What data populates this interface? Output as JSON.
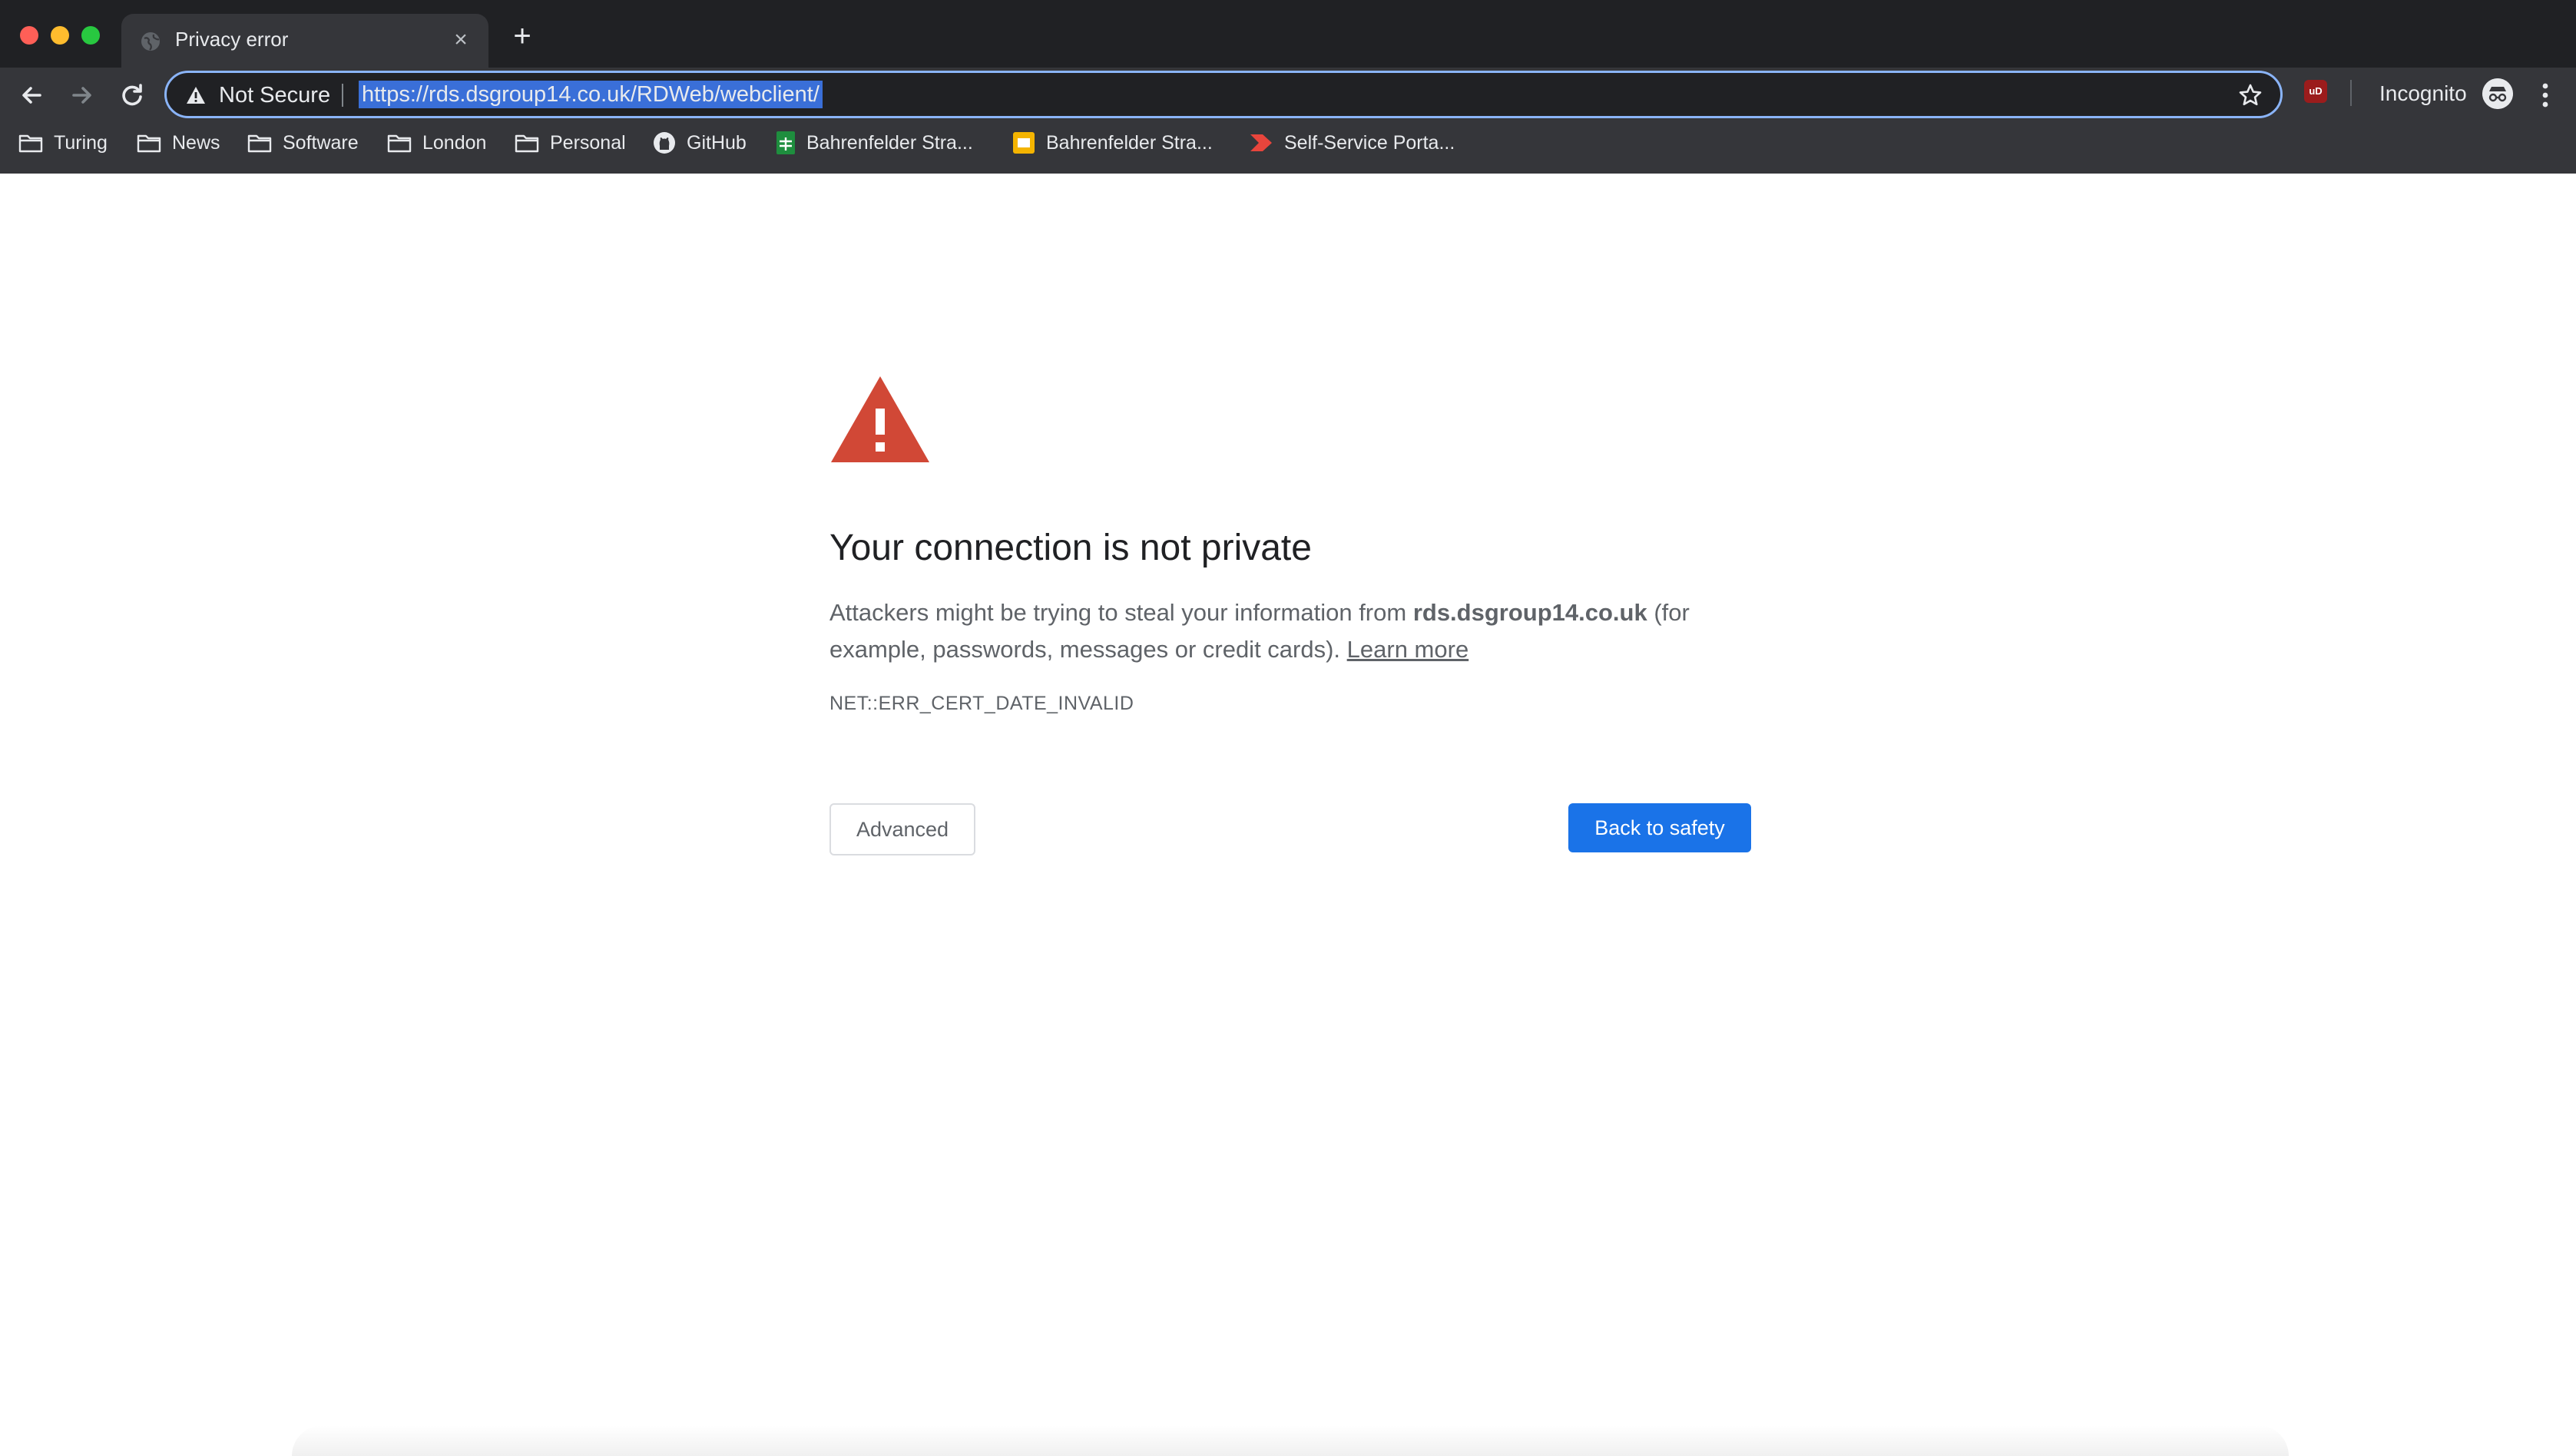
{
  "window": {
    "tab_title": "Privacy error",
    "tab_close": "×",
    "new_tab": "+"
  },
  "toolbar": {
    "security_status": "Not Secure",
    "url": "https://rds.dsgroup14.co.uk/RDWeb/webclient/",
    "ublock_badge": "uD",
    "incognito_label": "Incognito"
  },
  "bookmarks": [
    {
      "label": "Turing",
      "icon": "folder-icon"
    },
    {
      "label": "News",
      "icon": "folder-icon"
    },
    {
      "label": "Software",
      "icon": "folder-icon"
    },
    {
      "label": "London",
      "icon": "folder-icon"
    },
    {
      "label": "Personal",
      "icon": "folder-icon"
    },
    {
      "label": "GitHub",
      "icon": "github-icon"
    },
    {
      "label": "Bahrenfelder Stra...",
      "icon": "sheets-icon"
    },
    {
      "label": "Bahrenfelder Stra...",
      "icon": "slides-icon"
    },
    {
      "label": "Self-Service Porta...",
      "icon": "arrow-brand-icon"
    }
  ],
  "interstitial": {
    "heading": "Your connection is not private",
    "body_prefix": "Attackers might be trying to steal your information from ",
    "domain": "rds.dsgroup14.co.uk",
    "body_suffix": " (for example, passwords, messages or credit cards). ",
    "learn_more": "Learn more",
    "error_code": "NET::ERR_CERT_DATE_INVALID",
    "advanced_button": "Advanced",
    "back_button": "Back to safety"
  },
  "colors": {
    "titlebar": "#202124",
    "toolbar": "#35363a",
    "warning_red": "#d14836",
    "primary_blue": "#1a73e8"
  }
}
